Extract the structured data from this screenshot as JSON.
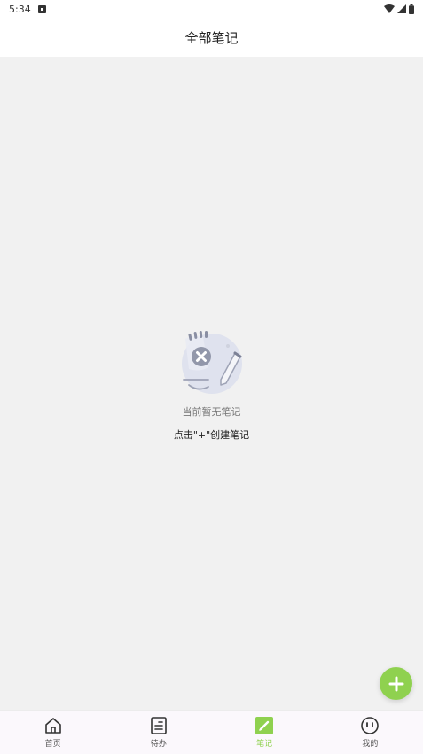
{
  "status_bar": {
    "time": "5:34"
  },
  "header": {
    "title": "全部笔记"
  },
  "empty_state": {
    "title": "当前暂无笔记",
    "hint": "点击\"+\"创建笔记"
  },
  "fab": {
    "icon": "plus-icon"
  },
  "bottom_nav": {
    "items": [
      {
        "label": "首页",
        "icon": "home-icon",
        "active": false
      },
      {
        "label": "待办",
        "icon": "todo-icon",
        "active": false
      },
      {
        "label": "笔记",
        "icon": "note-icon",
        "active": true
      },
      {
        "label": "我的",
        "icon": "profile-icon",
        "active": false
      }
    ]
  },
  "colors": {
    "accent": "#8fd14f",
    "background": "#f1f1f1",
    "header_bg": "#ffffff",
    "nav_bg": "#fbf8fc"
  }
}
